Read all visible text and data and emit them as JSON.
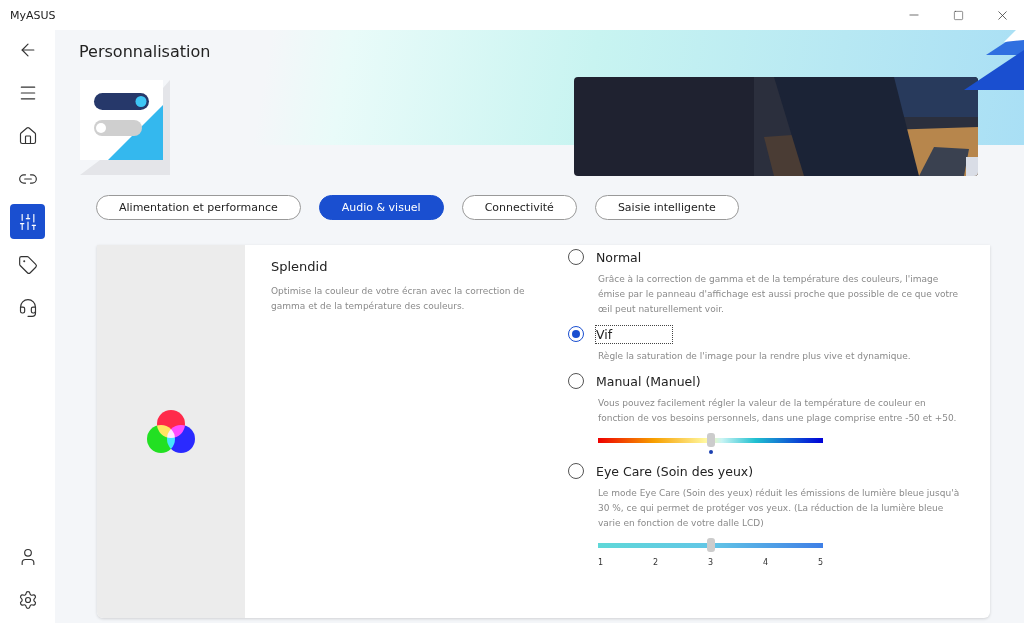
{
  "window": {
    "title": "MyASUS"
  },
  "sidebar": {
    "items": [
      {
        "selected": false
      },
      {
        "selected": false
      },
      {
        "selected": false
      },
      {
        "selected": false
      },
      {
        "selected": true
      },
      {
        "selected": false
      },
      {
        "selected": false
      }
    ],
    "bottom_items": [
      {
        "selected": false
      },
      {
        "selected": false
      }
    ]
  },
  "page": {
    "title": "Personnalisation"
  },
  "tabs": [
    {
      "label": "Alimentation et performance",
      "selected": false
    },
    {
      "label": "Audio & visuel",
      "selected": true
    },
    {
      "label": "Connectivité",
      "selected": false
    },
    {
      "label": "Saisie intelligente",
      "selected": false
    }
  ],
  "setting": {
    "title": "Splendid",
    "description": "Optimise la couleur de votre écran avec la correction de gamma et de la température des couleurs.",
    "options": [
      {
        "label": "Normal",
        "selected": false,
        "focused": false,
        "description": "Grâce à la correction de gamma et de la température des couleurs, l'image émise par le panneau d'affichage est aussi proche que possible de ce que votre œil peut naturellement voir."
      },
      {
        "label": "Vif",
        "selected": true,
        "focused": true,
        "description": "Règle la saturation de l'image pour la rendre plus vive et dynamique."
      },
      {
        "label": "Manual (Manuel)",
        "selected": false,
        "focused": false,
        "description": "Vous pouvez facilement régler la valeur de la température de couleur en fonction de vos besoins personnels, dans une plage comprise entre -50 et +50.",
        "slider": {
          "kind": "spectrum",
          "level": 0.5
        }
      },
      {
        "label": "Eye Care (Soin des yeux)",
        "selected": false,
        "focused": false,
        "description": "Le mode Eye Care (Soin des yeux) réduit les émissions de lumière bleue jusqu'à 30 %, ce qui permet de protéger vos yeux. (La réduction de la lumière bleue varie en fonction de votre dalle LCD)",
        "slider": {
          "kind": "steps",
          "level": 0.5,
          "ticks": [
            "1",
            "2",
            "3",
            "4",
            "5"
          ]
        }
      }
    ]
  }
}
